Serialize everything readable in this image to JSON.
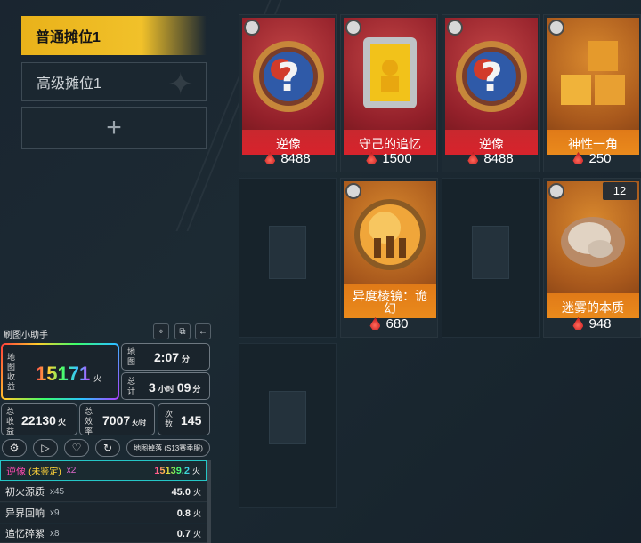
{
  "tabs": {
    "active": "普通摊位1",
    "inactive": "高级摊位1",
    "add": "+"
  },
  "items": [
    {
      "name": "逆像",
      "price": "8488",
      "rarity": "red"
    },
    {
      "name": "守己的追忆",
      "price": "1500",
      "rarity": "red"
    },
    {
      "name": "逆像",
      "price": "8488",
      "rarity": "red"
    },
    {
      "name": "神性一角",
      "price": "250",
      "rarity": "orange"
    },
    {
      "name": "异度棱镜：诡幻",
      "price": "680",
      "rarity": "orange"
    },
    {
      "name": "迷雾的本质",
      "price": "948",
      "rarity": "orange",
      "qty": "12"
    }
  ],
  "helper": {
    "title": "刷图小助手",
    "map_income_label": "地图收益",
    "map_income": "15171",
    "unit_fire": "火",
    "map_label": "地图",
    "map_time": "2:07",
    "map_time_unit": "分",
    "total_label": "总计",
    "total_hours": "3",
    "hour_unit": "小时",
    "total_minutes": "09",
    "minute_unit": "分",
    "total_income_label": "总收益",
    "total_income": "22130",
    "efficiency_label": "总效率",
    "efficiency": "7007",
    "efficiency_unit": "火/时",
    "count_label": "次数",
    "count": "145",
    "drops_button": "地图掉落 (S13赛季服)"
  },
  "drops": [
    {
      "name": "逆像",
      "tag": "(未鉴定)",
      "qty": "x2",
      "amount": "15139.2",
      "unit": "火"
    },
    {
      "name": "初火源质",
      "qty": "x45",
      "amount": "45.0",
      "unit": "火"
    },
    {
      "name": "异界回响",
      "qty": "x9",
      "amount": "0.8",
      "unit": "火"
    },
    {
      "name": "追忆碎絮",
      "qty": "x8",
      "amount": "0.7",
      "unit": "火"
    }
  ]
}
